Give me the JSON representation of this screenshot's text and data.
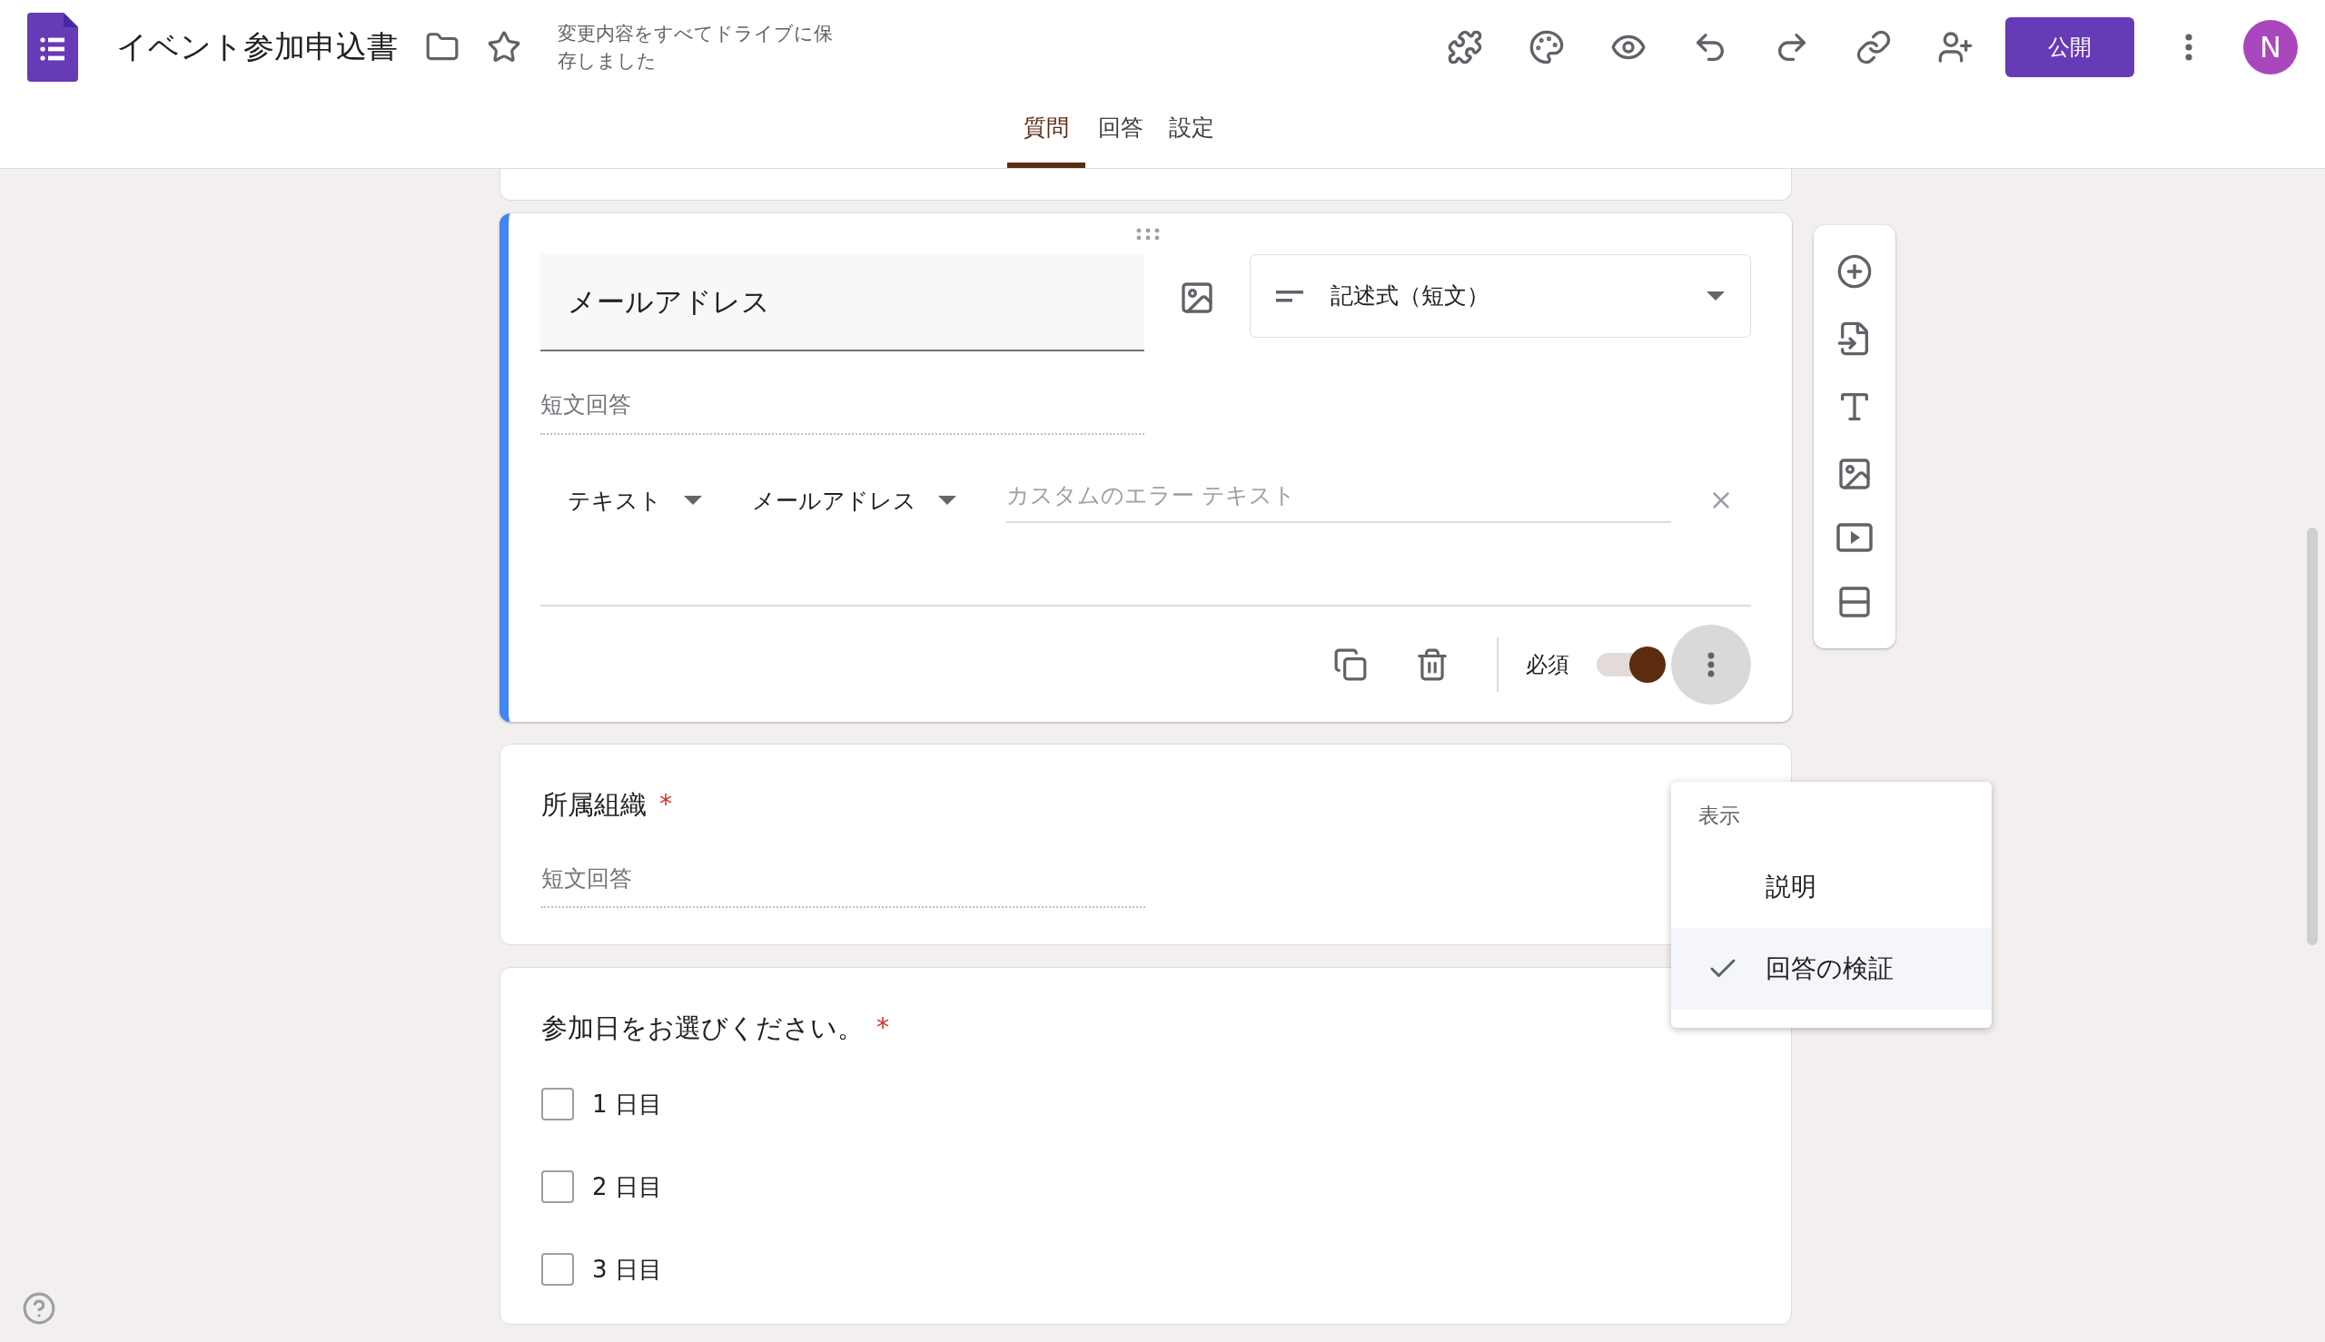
{
  "app": {
    "title": "イベント参加申込書",
    "save_status": "変更内容をすべてドライブに保存しました",
    "publish_button": "公開",
    "avatar": "N"
  },
  "tabs": [
    {
      "label": "質問",
      "selected": true
    },
    {
      "label": "回答",
      "selected": false
    },
    {
      "label": "設定",
      "selected": false
    }
  ],
  "active_question": {
    "title": "メールアドレス",
    "type": "記述式（短文）",
    "answer_placeholder": "短文回答",
    "validation": {
      "category": "テキスト",
      "rule": "メールアドレス",
      "error_placeholder": "カスタムのエラー テキスト"
    },
    "required_label": "必須",
    "required": true
  },
  "menu": {
    "header": "表示",
    "items": [
      {
        "label": "説明",
        "checked": false
      },
      {
        "label": "回答の検証",
        "checked": true
      }
    ]
  },
  "required_mark": "*",
  "questions": [
    {
      "kind": "short",
      "title": "所属組織",
      "required": true,
      "answer_placeholder": "短文回答"
    },
    {
      "kind": "checkbox",
      "title": "参加日をお選びください。",
      "required": true,
      "options": [
        {
          "label": "1 日目",
          "checked": false
        },
        {
          "label": "2 日目",
          "checked": false
        },
        {
          "label": "3 日目",
          "checked": false
        }
      ]
    }
  ]
}
